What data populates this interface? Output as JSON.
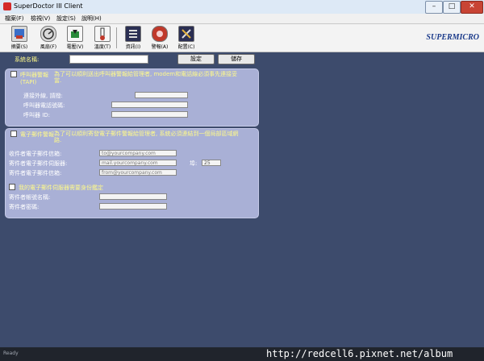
{
  "window": {
    "title": "SuperDoctor III Client",
    "min": "–",
    "max": "□",
    "close": "✕"
  },
  "menu": [
    "檔案(F)",
    "檢視(V)",
    "設定(S)",
    "說明(H)"
  ],
  "toolbar": {
    "buttons": [
      {
        "label": "摘要(S)",
        "icon": "summary-icon"
      },
      {
        "label": "風扇(F)",
        "icon": "fan-icon"
      },
      {
        "label": "電壓(V)",
        "icon": "voltage-icon"
      },
      {
        "label": "溫度(T)",
        "icon": "temperature-icon"
      },
      {
        "label": "資訊(I)",
        "icon": "info-icon"
      },
      {
        "label": "警報(A)",
        "icon": "alarm-icon"
      },
      {
        "label": "配置(C)",
        "icon": "config-icon"
      }
    ],
    "brand": "SUPERMICRO"
  },
  "system": {
    "label": "系統名稱:",
    "value": "",
    "set_btn": "設定",
    "save_btn": "儲存"
  },
  "pager": {
    "header": "呼叫器警報 (TAPI)",
    "desc": "為了可以順利送出呼叫器警報給管理者, modem和電話線必須事先連接妥當.",
    "fields": [
      {
        "label": "連接外線, 請撥:",
        "value": ""
      },
      {
        "label": "呼叫器電話號碼:",
        "value": ""
      },
      {
        "label": "呼叫器 ID:",
        "value": ""
      }
    ]
  },
  "email": {
    "header": "電子郵件警報",
    "desc": "為了可以順利寄發電子郵件警報給管理者, 系統必須連結到一個局部區域網路.",
    "recipient_label": "收件者電子郵件信箱:",
    "recipient_value": "to@yourcompany.com",
    "server_label": "寄件者電子郵件伺服器:",
    "server_value": "mail.yourcompany.com",
    "port_label": "埠:",
    "port_value": "25",
    "sender_label": "寄件者電子郵件信箱:",
    "sender_value": "from@yourcompany.com",
    "auth_label": "我的電子郵件伺服器需要身份鑑定",
    "account_label": "寄件者帳號名稱:",
    "account_value": "",
    "password_label": "寄件者密碼:",
    "password_value": ""
  },
  "status": {
    "text": "Ready",
    "watermark": "http://redcell6.pixnet.net/album"
  }
}
